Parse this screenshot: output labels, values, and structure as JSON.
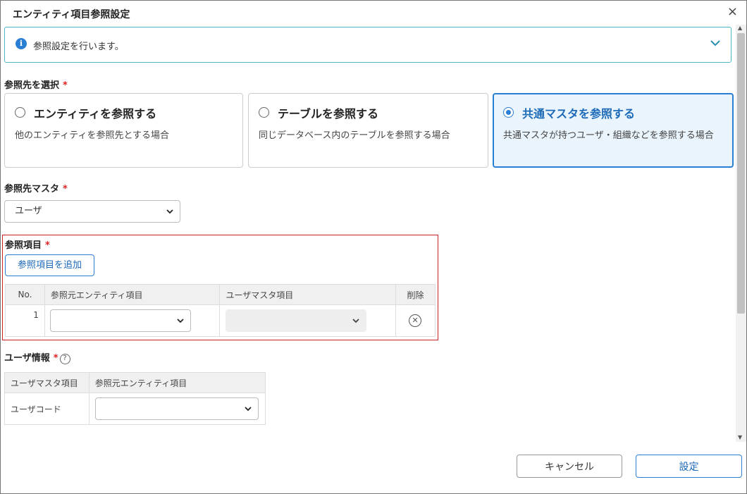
{
  "dialog": {
    "title": "エンティティ項目参照設定",
    "close_glyph": "×"
  },
  "info": {
    "icon_glyph": "i",
    "text": "参照設定を行います。"
  },
  "reference_target": {
    "label": "参照先を選択",
    "required_mark": "*",
    "options": [
      {
        "title": "エンティティを参照する",
        "description": "他のエンティティを参照先とする場合",
        "selected": false
      },
      {
        "title": "テーブルを参照する",
        "description": "同じデータベース内のテーブルを参照する場合",
        "selected": false
      },
      {
        "title": "共通マスタを参照する",
        "description": "共通マスタが持つユーザ・組織などを参照する場合",
        "selected": true
      }
    ]
  },
  "master": {
    "label": "参照先マスタ",
    "required_mark": "*",
    "selected_value": "ユーザ"
  },
  "reference_items": {
    "label": "参照項目",
    "required_mark": "*",
    "add_button": "参照項目を追加",
    "columns": [
      "No.",
      "参照元エンティティ項目",
      "ユーザマスタ項目",
      "削除"
    ],
    "rows": [
      {
        "no": "1",
        "source_value": "",
        "master_value": ""
      }
    ]
  },
  "user_info": {
    "label": "ユーザ情報",
    "required_mark": "*",
    "help_glyph": "?",
    "columns": [
      "ユーザマスタ項目",
      "参照元エンティティ項目"
    ],
    "rows": [
      {
        "master_item": "ユーザコード",
        "source_value": ""
      }
    ]
  },
  "footer": {
    "cancel": "キャンセル",
    "ok": "設定"
  },
  "colors": {
    "accent": "#2a7fd4",
    "info_border": "#4db6c4",
    "required": "#dd2222",
    "highlight_box": "#cc2222"
  }
}
